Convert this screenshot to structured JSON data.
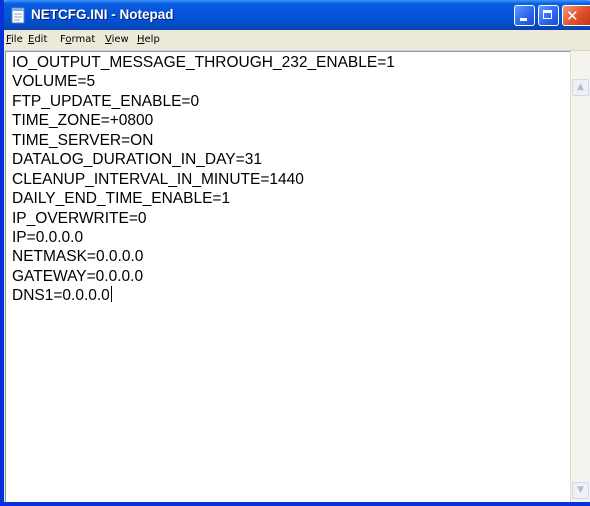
{
  "window": {
    "title": "NETCFG.INI - Notepad",
    "caption_buttons": {
      "minimize": "minimize-icon",
      "maximize": "maximize-icon",
      "close": "close-icon"
    },
    "colors": {
      "titlebar": "#0453d6",
      "close_button": "#e2552d",
      "frame": "#0831d9"
    }
  },
  "menu": {
    "file": {
      "mnemonic": "F",
      "rest": "ile"
    },
    "edit": {
      "mnemonic": "E",
      "rest": "dit"
    },
    "format": {
      "pre": "F",
      "mnemonic": "o",
      "rest": "rmat"
    },
    "view": {
      "mnemonic": "V",
      "rest": "iew"
    },
    "help": {
      "mnemonic": "H",
      "rest": "elp"
    }
  },
  "editor": {
    "lines": [
      "IO_OUTPUT_MESSAGE_THROUGH_232_ENABLE=1",
      "VOLUME=5",
      "FTP_UPDATE_ENABLE=0",
      "TIME_ZONE=+0800",
      "TIME_SERVER=ON",
      "DATALOG_DURATION_IN_DAY=31",
      "CLEANUP_INTERVAL_IN_MINUTE=1440",
      "DAILY_END_TIME_ENABLE=1",
      "IP_OVERWRITE=0",
      "IP=0.0.0.0",
      "NETMASK=0.0.0.0",
      "GATEWAY=0.0.0.0",
      "DNS1=0.0.0.0"
    ]
  }
}
